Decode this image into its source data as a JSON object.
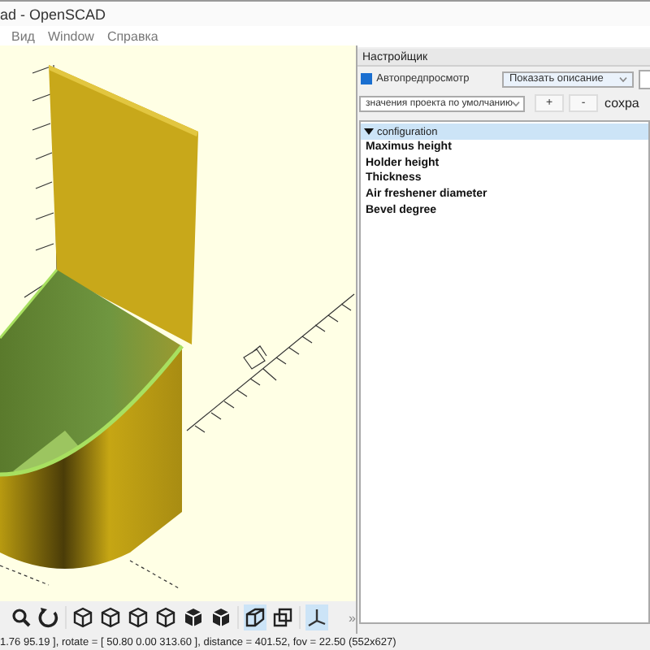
{
  "window": {
    "title": "ad - OpenSCAD"
  },
  "menu": [
    "Вид",
    "Window",
    "Справка"
  ],
  "toolbar": [
    {
      "kind": "zoom",
      "selected": false
    },
    {
      "kind": "reset",
      "selected": false
    },
    {
      "kind": "view",
      "selected": false
    },
    {
      "kind": "view",
      "selected": false
    },
    {
      "kind": "view",
      "selected": false
    },
    {
      "kind": "view",
      "selected": false
    },
    {
      "kind": "cube",
      "selected": false
    },
    {
      "kind": "cube",
      "selected": false
    },
    {
      "kind": "perspective",
      "selected": true
    },
    {
      "kind": "orthogonal",
      "selected": false
    },
    {
      "kind": "axes",
      "selected": true
    }
  ],
  "toolbar_more": "»",
  "customizer": {
    "title": "Настройщик",
    "auto_preview": {
      "label": "Автопредпросмотр",
      "checked": true
    },
    "description_mode": "Показать описание",
    "preset": "значения проекта по умолчанию",
    "buttons": [
      "+",
      "-"
    ],
    "save": "сохра",
    "groups": [
      {
        "title": "configuration",
        "expanded": true,
        "selected": true,
        "items": [
          "Maximus height",
          "Holder height",
          "Thickness",
          "Air freshener diameter",
          "Bevel degree"
        ]
      }
    ]
  },
  "status_bar": "1.76 95.19 ], rotate = [ 50.80 0.00 313.60 ], distance = 401.52, fov = 22.50 (552x627)"
}
